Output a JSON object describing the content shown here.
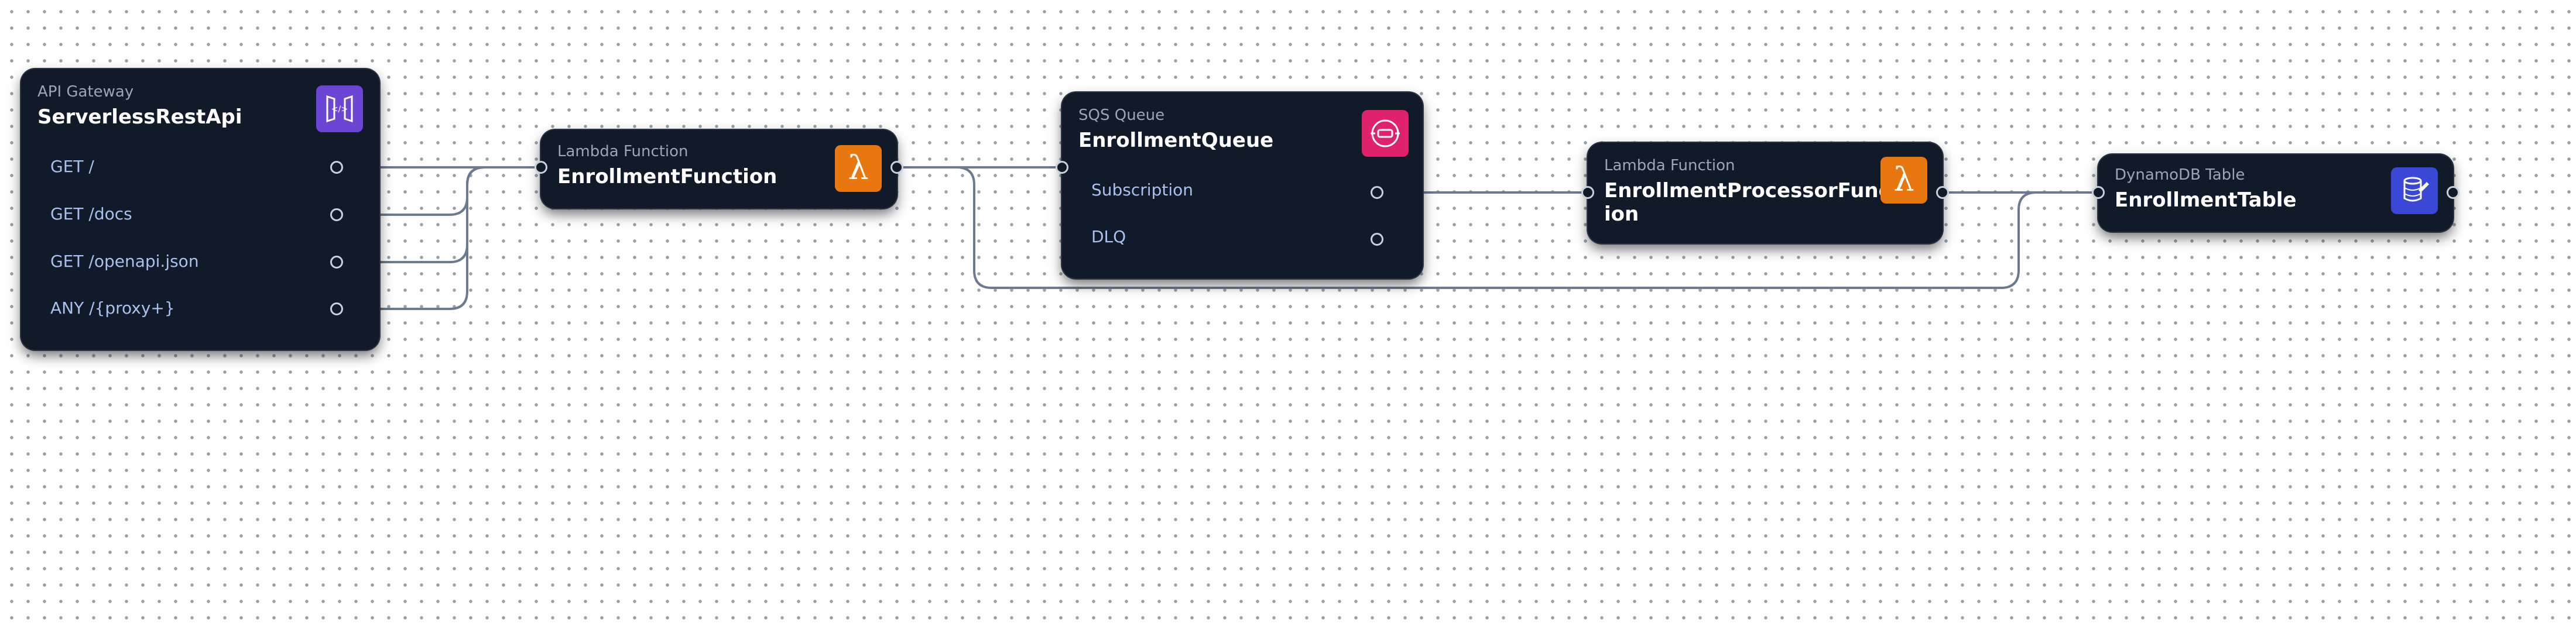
{
  "nodes": {
    "api": {
      "type": "API Gateway",
      "title": "ServerlessRestApi",
      "icon": "api-gateway-icon",
      "color": "#6b46d4",
      "routes": [
        "GET /",
        "GET /docs",
        "GET /openapi.json",
        "ANY /{proxy+}"
      ]
    },
    "fn": {
      "type": "Lambda Function",
      "title": "EnrollmentFunction",
      "icon": "lambda-icon",
      "color": "#e8770f"
    },
    "queue": {
      "type": "SQS Queue",
      "title": "EnrollmentQueue",
      "icon": "sqs-icon",
      "color": "#e0216b",
      "ports": [
        "Subscription",
        "DLQ"
      ]
    },
    "proc": {
      "type": "Lambda Function",
      "title_line1": "EnrollmentProcessorFunct",
      "title_line2": "ion",
      "icon": "lambda-icon",
      "color": "#e8770f"
    },
    "table": {
      "type": "DynamoDB Table",
      "title": "EnrollmentTable",
      "icon": "dynamodb-icon",
      "color": "#3b47d6"
    }
  }
}
